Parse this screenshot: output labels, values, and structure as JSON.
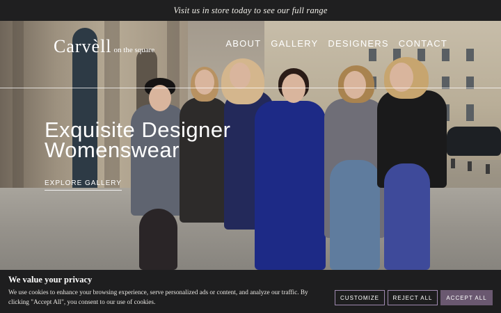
{
  "announcement": {
    "text": "Visit us in store today to see our full range"
  },
  "header": {
    "logo_main": "Carvèll",
    "logo_sub": "on the square",
    "nav": [
      "ABOUT",
      "GALLERY",
      "DESIGNERS",
      "CONTACT"
    ]
  },
  "hero": {
    "headline_line1": "Exquisite Designer",
    "headline_line2": "Womenswear",
    "cta": "EXPLORE GALLERY"
  },
  "cookie": {
    "title": "We value your privacy",
    "text": "We use cookies to enhance your browsing experience, serve personalized ads or content, and analyze our traffic. By clicking \"Accept All\", you consent to our use of cookies.",
    "customize": "CUSTOMIZE",
    "reject": "REJECT ALL",
    "accept": "ACCEPT ALL"
  },
  "colors": {
    "dark_bar": "#1e1e1f",
    "accent": "#6a5870",
    "button_border": "#a08ab0"
  }
}
